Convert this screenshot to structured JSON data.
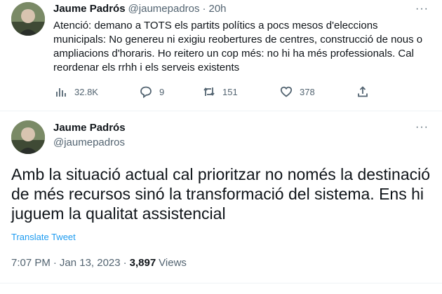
{
  "reply_tweet": {
    "author_name": "Jaume Padrós",
    "author_handle": "@jaumepadros",
    "separator": "·",
    "age": "20h",
    "text": "Atenció: demano a TOTS els partits polítics a pocs mesos d'eleccions municipals: No genereu ni exigiu reobertures de centres, construcció de nous o ampliacions d'horaris. Ho reitero un cop més: no hi ha més professionals. Cal reordenar els rrhh i els serveis existents",
    "more_label": "···",
    "actions": {
      "views": "32.8K",
      "replies": "9",
      "retweets": "151",
      "likes": "378"
    }
  },
  "main_tweet": {
    "author_name": "Jaume Padrós",
    "author_handle": "@jaumepadros",
    "more_label": "···",
    "text": "Amb la situació actual cal prioritzar no només la destinació de més recursos sinó la transformació del sistema. Ens hi juguem la qualitat assistencial",
    "translate_label": "Translate Tweet",
    "time": "7:07 PM",
    "date": "Jan 13, 2023",
    "dot": "·",
    "views_count": "3,897",
    "views_label": "Views"
  },
  "icons": {
    "views": "bar-chart-icon",
    "reply": "speech-bubble-icon",
    "retweet": "retweet-arrows-icon",
    "like": "heart-icon",
    "share": "share-upload-icon",
    "more": "more-dots-icon"
  }
}
